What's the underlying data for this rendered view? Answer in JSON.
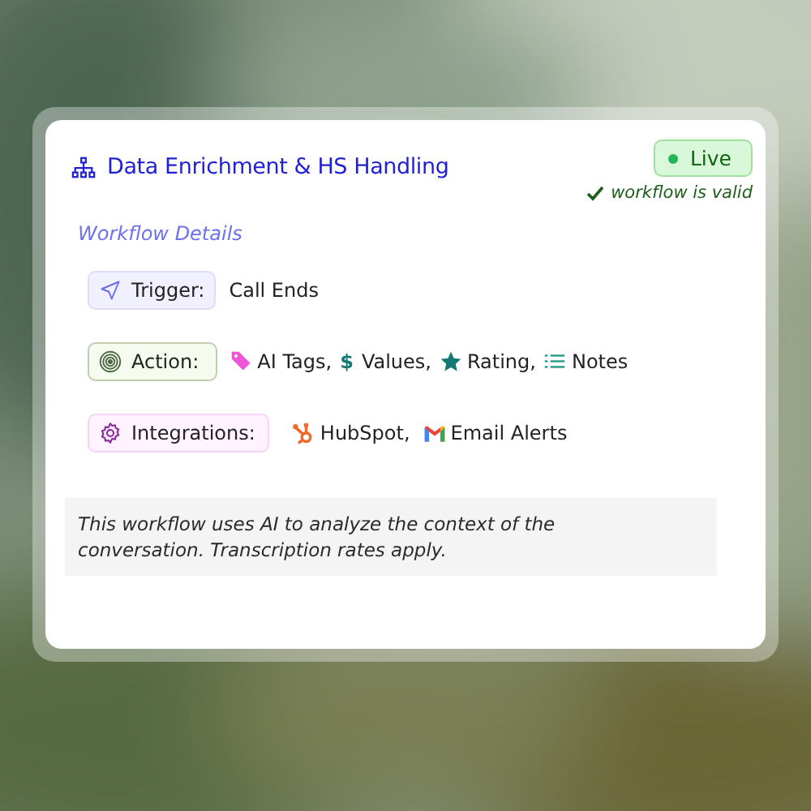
{
  "title": "Data Enrichment & HS Handling",
  "status": {
    "label": "Live",
    "live": true
  },
  "validity": {
    "label": "workflow is valid",
    "valid": true
  },
  "section_title": "Workflow Details",
  "rows": [
    {
      "kind": "trigger",
      "label": "Trigger:",
      "items": [
        {
          "kind": "plain",
          "text": "Call Ends"
        }
      ]
    },
    {
      "kind": "action",
      "label": "Action:",
      "items": [
        {
          "kind": "tag",
          "text": "AI Tags,"
        },
        {
          "kind": "symbol",
          "symbol": "$",
          "text": "Values,"
        },
        {
          "kind": "star",
          "text": "Rating,"
        },
        {
          "kind": "list",
          "text": "Notes"
        }
      ]
    },
    {
      "kind": "integrations",
      "label": "Integrations:",
      "items": [
        {
          "kind": "hubspot",
          "text": "HubSpot,"
        },
        {
          "kind": "gmail",
          "text": "Email Alerts"
        }
      ]
    }
  ],
  "note": "This workflow uses AI to analyze the context of the conversation. Transcription rates apply."
}
